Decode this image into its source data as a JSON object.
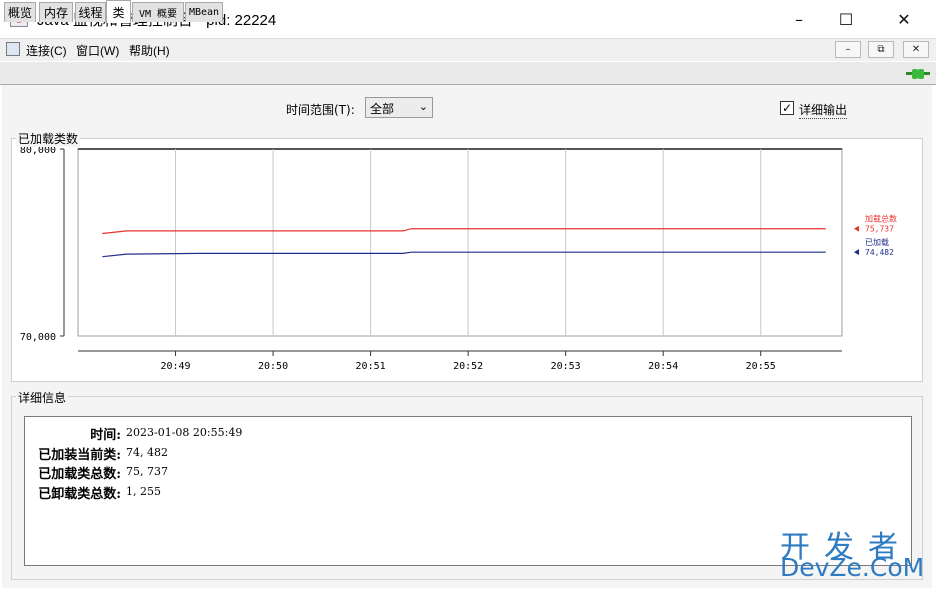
{
  "window": {
    "title": "Java 监视和管理控制台 - pid: 22224",
    "controls": [
      "–",
      "☐",
      "✕"
    ]
  },
  "menu": {
    "items": [
      "连接(C)",
      "窗口(W)",
      "帮助(H)"
    ],
    "mdi_controls": [
      "–",
      "⧉",
      "✕"
    ]
  },
  "tabs": [
    {
      "label": "概览",
      "active": false
    },
    {
      "label": "内存",
      "active": false
    },
    {
      "label": "线程",
      "active": false
    },
    {
      "label": "类",
      "active": true
    },
    {
      "label": "VM 概要",
      "active": false
    },
    {
      "label": "MBean",
      "active": false
    }
  ],
  "toolbar": {
    "time_range_label": "时间范围(T):",
    "time_range_value": "全部",
    "detail_output_label": "详细输出",
    "detail_output_checked": true
  },
  "chart_section": {
    "title": "已加载类数"
  },
  "chart_data": {
    "type": "line",
    "x": [
      "20:48:15",
      "20:48:30",
      "20:49:15",
      "20:51:20",
      "20:51:25",
      "20:55:40"
    ],
    "tick_labels_x": [
      "20:49",
      "20:50",
      "20:51",
      "20:52",
      "20:53",
      "20:54",
      "20:55"
    ],
    "ylim": [
      70000,
      80000
    ],
    "tick_labels_y": [
      "80,000",
      "70,000"
    ],
    "grid": true,
    "series": [
      {
        "name": "加载总数",
        "color": "#e8322f",
        "values": [
          75480,
          75620,
          75620,
          75620,
          75737,
          75737
        ],
        "end_label": "75,737"
      },
      {
        "name": "已加载",
        "color": "#1f2e8c",
        "values": [
          74240,
          74380,
          74420,
          74420,
          74482,
          74482
        ],
        "end_label": "74,482"
      }
    ]
  },
  "details": {
    "title": "详细信息",
    "rows": [
      {
        "label": "时间:",
        "value": "2023-01-08 20:55:49"
      },
      {
        "label": "已加装当前类:",
        "value": "74, 482"
      },
      {
        "label": "已加载类总数:",
        "value": "75, 737"
      },
      {
        "label": "已卸载类总数:",
        "value": "1, 255"
      }
    ]
  },
  "watermark": {
    "line1": "开发者",
    "line2": "DevZe.CoM"
  },
  "colors": {
    "series_total": "#e8322f",
    "series_loaded": "#1f2e8c",
    "watermark": "#2f7bc2"
  }
}
